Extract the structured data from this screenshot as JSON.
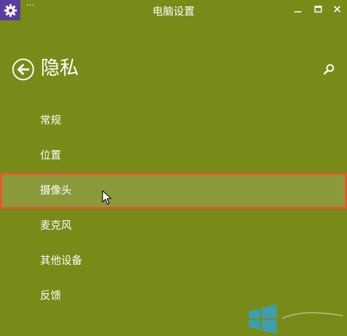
{
  "window": {
    "title": "电脑设置",
    "more_glyph": "···"
  },
  "icons": {
    "app": "gear-icon",
    "back": "back-arrow-icon",
    "search": "search-icon",
    "minimize": "minimize-icon",
    "maximize": "maximize-icon",
    "close": "close-icon",
    "cursor": "mouse-pointer-icon"
  },
  "colors": {
    "background": "#788a18",
    "app_icon_bg": "#5b3da0",
    "selected_bg": "#8a9a3a",
    "selection_outline": "#e05a2c",
    "text": "#ffffff"
  },
  "header": {
    "title": "隐私"
  },
  "menu": {
    "items": [
      {
        "label": "常规"
      },
      {
        "label": "位置"
      },
      {
        "label": "摄像头",
        "selected": true
      },
      {
        "label": "麦克风"
      },
      {
        "label": "其他设备"
      },
      {
        "label": "反馈"
      }
    ]
  }
}
